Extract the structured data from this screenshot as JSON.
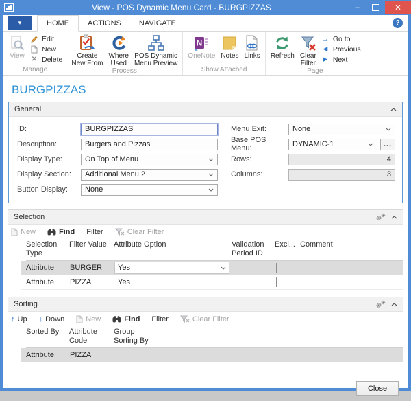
{
  "window": {
    "title": "View - POS Dynamic Menu Card - BURGPIZZAS",
    "minimize_glyph": "–",
    "close_glyph": "✕"
  },
  "app_menu_glyph": "▾",
  "help_glyph": "?",
  "ribbon": {
    "tabs": {
      "home": "HOME",
      "actions": "ACTIONS",
      "navigate": "NAVIGATE"
    },
    "manage": {
      "label": "Manage",
      "view": "View",
      "edit": "Edit",
      "new": "New",
      "delete": "Delete",
      "delete_glyph": "✕"
    },
    "process": {
      "label": "Process",
      "create1": "Create",
      "create2": "New From",
      "where1": "Where",
      "where2": "Used",
      "pos1": "POS Dynamic",
      "pos2": "Menu Preview"
    },
    "attached": {
      "label": "Show Attached",
      "onenote": "OneNote",
      "notes": "Notes",
      "links": "Links"
    },
    "page": {
      "label": "Page",
      "refresh": "Refresh",
      "clear1": "Clear",
      "clear2": "Filter",
      "goto": "Go to",
      "goto_glyph": "→",
      "previous": "Previous",
      "prev_glyph": "◀",
      "next": "Next",
      "next_glyph": "▶"
    }
  },
  "page_title": "BURGPIZZAS",
  "general": {
    "header": "General",
    "id_label": "ID:",
    "id_value": "BURGPIZZAS",
    "desc_label": "Description:",
    "desc_value": "Burgers and Pizzas",
    "display_type_label": "Display Type:",
    "display_type_value": "On Top of Menu",
    "display_section_label": "Display Section:",
    "display_section_value": "Additional Menu 2",
    "button_display_label": "Button Display:",
    "button_display_value": "None",
    "menu_exit_label": "Menu Exit:",
    "menu_exit_value": "None",
    "base_pos_label": "Base POS Menu:",
    "base_pos_value": "DYNAMIC-1",
    "assist": "...",
    "rows_label": "Rows:",
    "rows_value": "4",
    "columns_label": "Columns:",
    "columns_value": "3"
  },
  "selection": {
    "header": "Selection",
    "toolbar": {
      "new": "New",
      "find": "Find",
      "filter": "Filter",
      "clear": "Clear Filter"
    },
    "col": {
      "c1a": "Selection",
      "c1b": "Type",
      "c2": "Filter Value",
      "c3": "Attribute Option",
      "c4a": "Validation",
      "c4b": "Period ID",
      "c5": "Excl...",
      "c6": "Comment"
    },
    "rows": [
      {
        "type": "Attribute",
        "filter": "BURGER",
        "option": "Yes",
        "validation_period_id": "",
        "excluded": false,
        "comment": "",
        "selected": true
      },
      {
        "type": "Attribute",
        "filter": "PIZZA",
        "option": "Yes",
        "validation_period_id": "",
        "excluded": false,
        "comment": "",
        "selected": false
      }
    ]
  },
  "sorting": {
    "header": "Sorting",
    "toolbar": {
      "up": "Up",
      "up_glyph": "↑",
      "down": "Down",
      "down_glyph": "↓",
      "new": "New",
      "find": "Find",
      "filter": "Filter",
      "clear": "Clear Filter"
    },
    "col": {
      "c1": "Sorted By",
      "c2a": "Attribute",
      "c2b": "Code",
      "c3a": "Group",
      "c3b": "Sorting By"
    },
    "rows": [
      {
        "sorted_by": "Attribute",
        "code": "PIZZA",
        "group_sorting_by": "",
        "selected": true
      }
    ]
  },
  "footer": {
    "close": "Close"
  },
  "colors": {
    "titlebar": "#4f8cd5",
    "close_red": "#e0544e",
    "accent_blue": "#2f93d6",
    "selected_row": "#dcdcdc",
    "app_menu": "#2a5ca8"
  }
}
